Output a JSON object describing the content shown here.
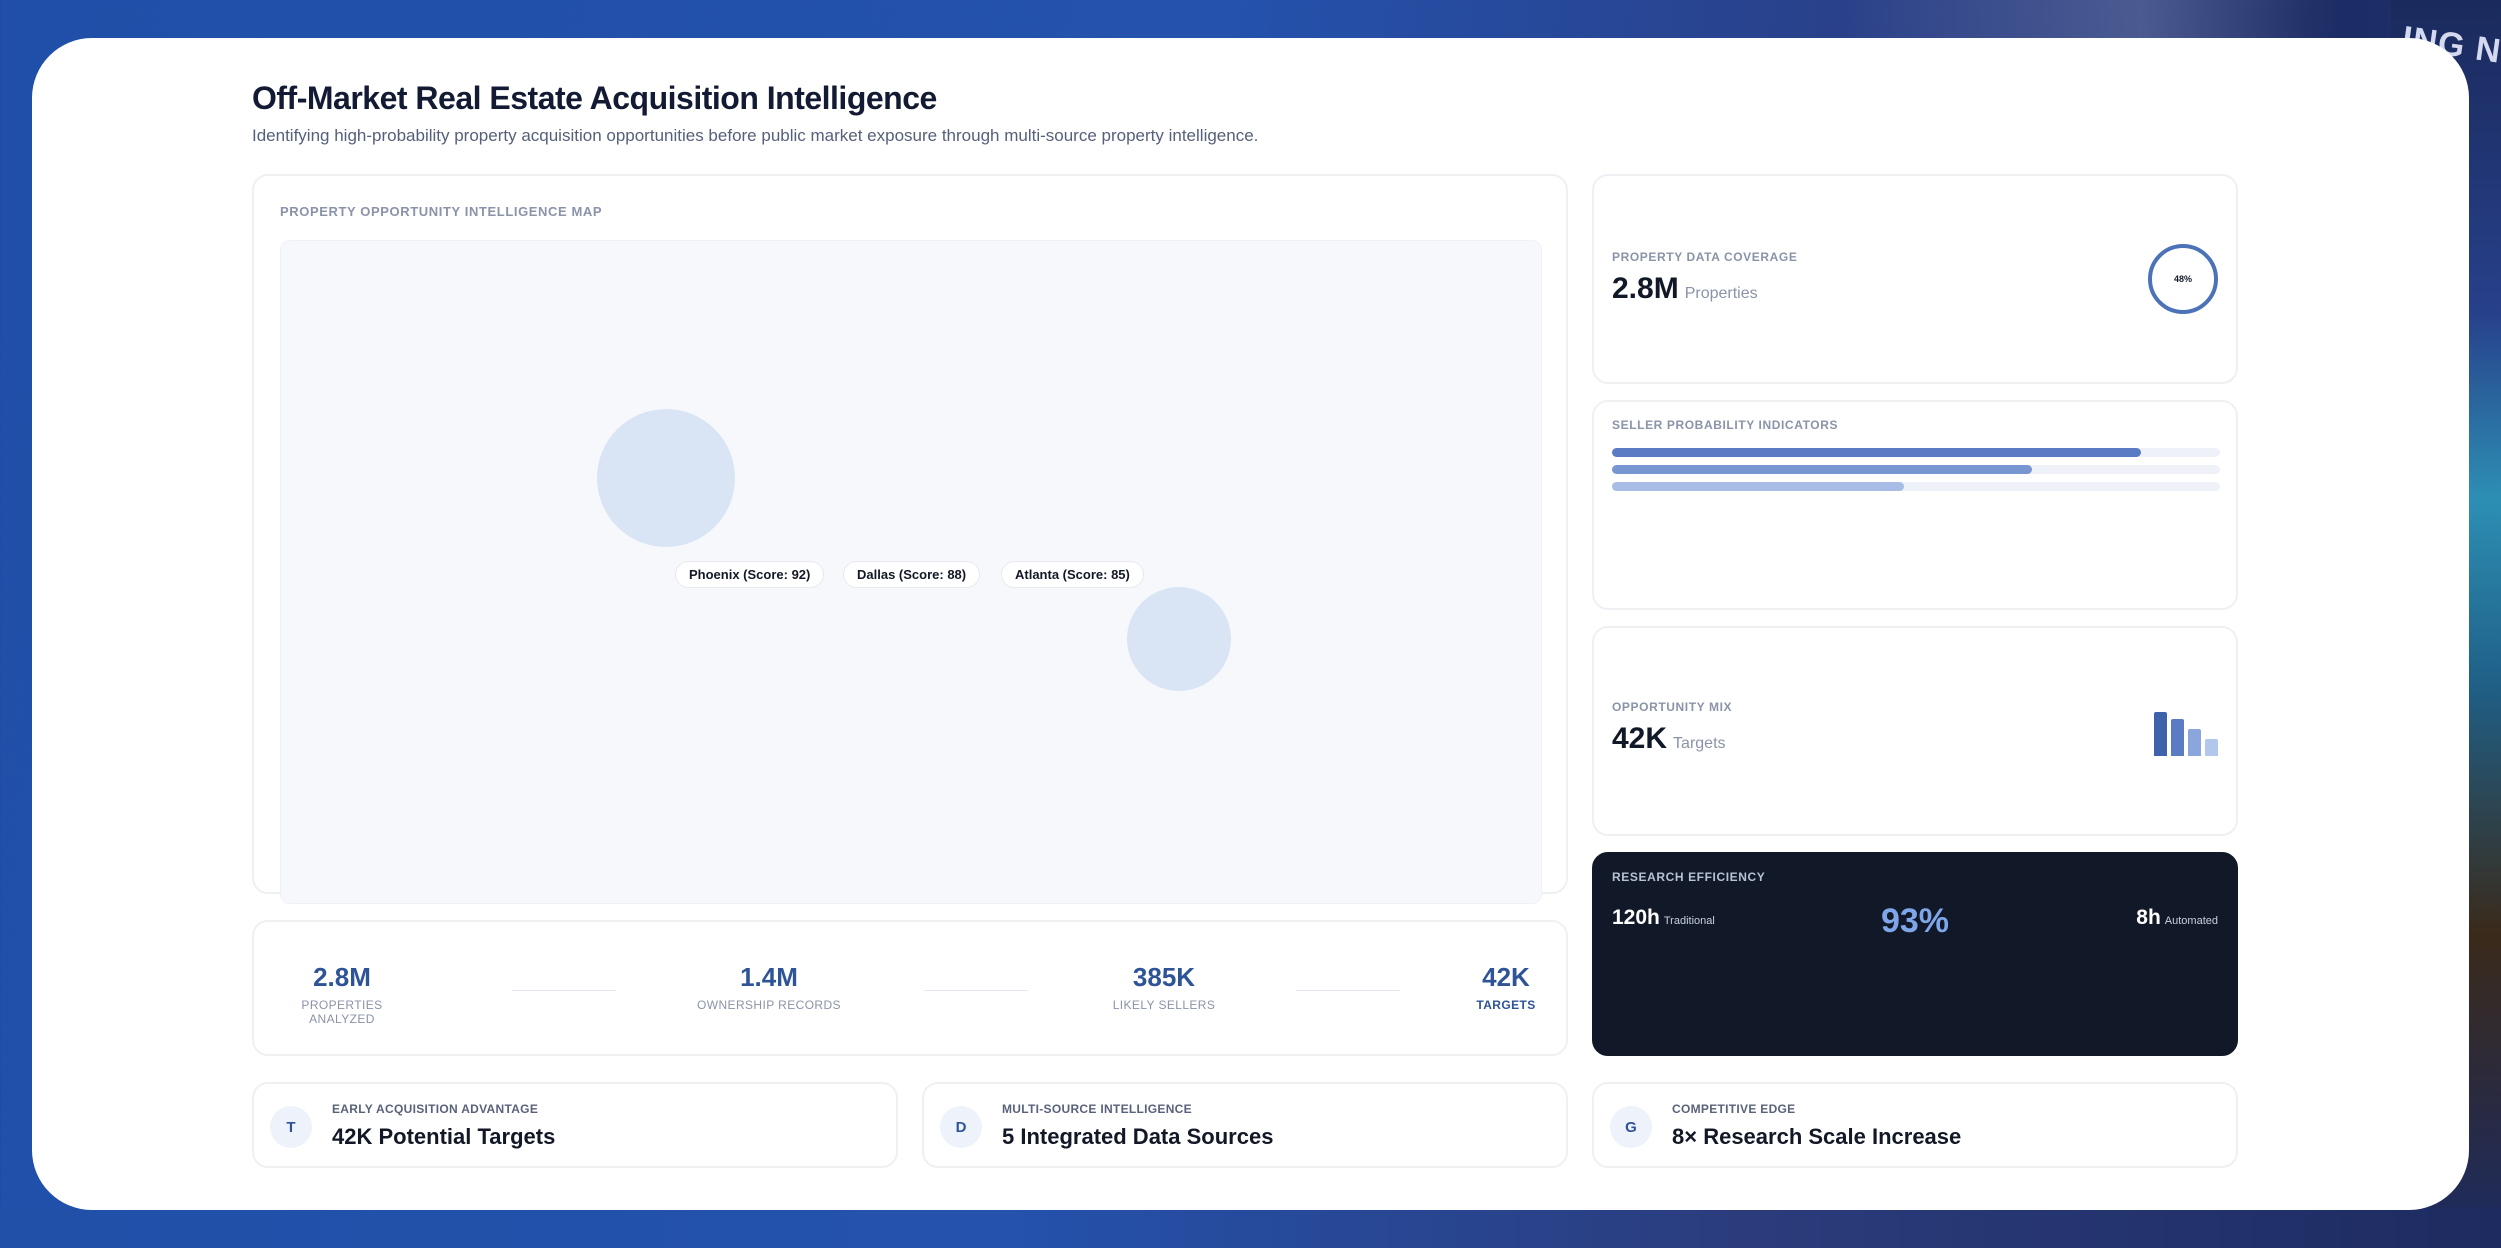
{
  "background": {
    "corner_text": "ING N"
  },
  "header": {
    "title": "Off-Market Real Estate Acquisition Intelligence",
    "subtitle": "Identifying high-probability property acquisition opportunities before public market exposure through multi-source property intelligence."
  },
  "map": {
    "label": "PROPERTY OPPORTUNITY INTELLIGENCE MAP",
    "pins": [
      "Phoenix (Score: 92)",
      "Dallas (Score: 88)",
      "Atlanta (Score: 85)"
    ]
  },
  "stats": [
    {
      "value": "2.8M",
      "label": "PROPERTIES ANALYZED"
    },
    {
      "value": "1.4M",
      "label": "OWNERSHIP RECORDS"
    },
    {
      "value": "385K",
      "label": "LIKELY SELLERS"
    },
    {
      "value": "42K",
      "label": "TARGETS"
    }
  ],
  "features": [
    {
      "badge": "T",
      "label": "EARLY ACQUISITION ADVANTAGE",
      "value": "42K Potential Targets"
    },
    {
      "badge": "D",
      "label": "MULTI-SOURCE INTELLIGENCE",
      "value": "5 Integrated Data Sources"
    },
    {
      "badge": "G",
      "label": "COMPETITIVE EDGE",
      "value": "8× Research Scale Increase"
    }
  ],
  "coverage": {
    "label": "PROPERTY DATA COVERAGE",
    "value": "2.8M",
    "unit": "Properties",
    "ring_text": "48%"
  },
  "seller": {
    "label": "SELLER PROBABILITY INDICATORS",
    "bars": [
      {
        "fraction": 0.87,
        "color": "#5b7cc4"
      },
      {
        "fraction": 0.69,
        "color": "#7896d1"
      },
      {
        "fraction": 0.48,
        "color": "#a7bde6"
      }
    ]
  },
  "mix": {
    "label": "OPPORTUNITY MIX",
    "value": "42K",
    "unit": "Targets",
    "bars": [
      {
        "fraction": 0.95,
        "color": "#3f62ad"
      },
      {
        "fraction": 0.8,
        "color": "#5b7cc4"
      },
      {
        "fraction": 0.58,
        "color": "#8aa6dc"
      },
      {
        "fraction": 0.38,
        "color": "#b3c7ec"
      }
    ]
  },
  "efficiency": {
    "label": "RESEARCH EFFICIENCY",
    "left_value": "120h",
    "left_sub": "Traditional",
    "center": "93%",
    "right_value": "8h",
    "right_sub": "Automated"
  },
  "colors": {
    "accent": "#2e5497",
    "dark": "#111827",
    "bubble": "#d9e4f5"
  }
}
